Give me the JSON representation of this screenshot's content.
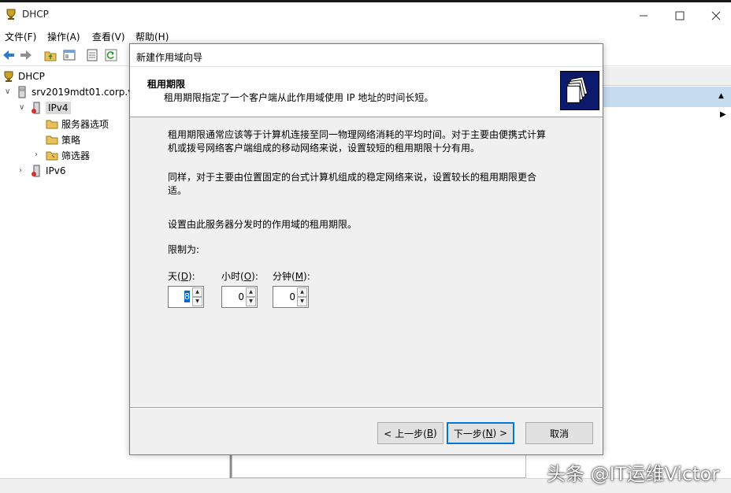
{
  "window": {
    "title": "DHCP",
    "controls": [
      "minimize-icon",
      "maximize-icon",
      "close-icon"
    ]
  },
  "menu": [
    {
      "label": "文件(F)"
    },
    {
      "label": "操作(A)"
    },
    {
      "label": "查看(V)"
    },
    {
      "label": "帮助(H)"
    }
  ],
  "toolbar": [
    "back-arrow-icon",
    "forward-arrow-icon",
    "folder-up-icon",
    "show-hide-tree-icon",
    "properties-icon",
    "refresh-icon"
  ],
  "tree": {
    "root": "DHCP",
    "server": "srv2019mdt01.corp.v",
    "ipv4": "IPv4",
    "server_options": "服务器选项",
    "policies": "策略",
    "filters": "筛选器",
    "ipv6": "IPv6"
  },
  "wizard": {
    "title": "新建作用域向导",
    "header_title": "租用期限",
    "header_subtitle": "租用期限指定了一个客户端从此作用域使用 IP 地址的时间长短。",
    "para1_line1": "租用期限通常应该等于计算机连接至同一物理网络消耗的平均时间。对于主要由便携式计算",
    "para1_line2": "机或拨号网络客户端组成的移动网络来说，设置较短的租用期限十分有用。",
    "para2_line1": "同样，对于主要由位置固定的台式计算机组成的稳定网络来说，设置较长的租用期限更合",
    "para2_line2": "适。",
    "set_duration": "设置由此服务器分发时的作用域的租用期限。",
    "limit_label": "限制为:",
    "days_label_pre": "天(",
    "days_key": "D",
    "days_label_post": "):",
    "hours_label_pre": "小时(",
    "hours_key": "O",
    "hours_label_post": "):",
    "minutes_label_pre": "分钟(",
    "minutes_key": "M",
    "minutes_label_post": "):",
    "days_value": "8",
    "hours_value": "0",
    "minutes_value": "0",
    "back_pre": "< 上一步(",
    "back_key": "B",
    "back_post": ")",
    "next_pre": "下一步(",
    "next_key": "N",
    "next_post": ") >",
    "cancel": "取消"
  },
  "watermark": "头条 @IT运维Victor",
  "colors": {
    "selection": "#c6dbee",
    "default_button_border": "#0078d7",
    "wizard_banner": "#0c1a6e"
  }
}
